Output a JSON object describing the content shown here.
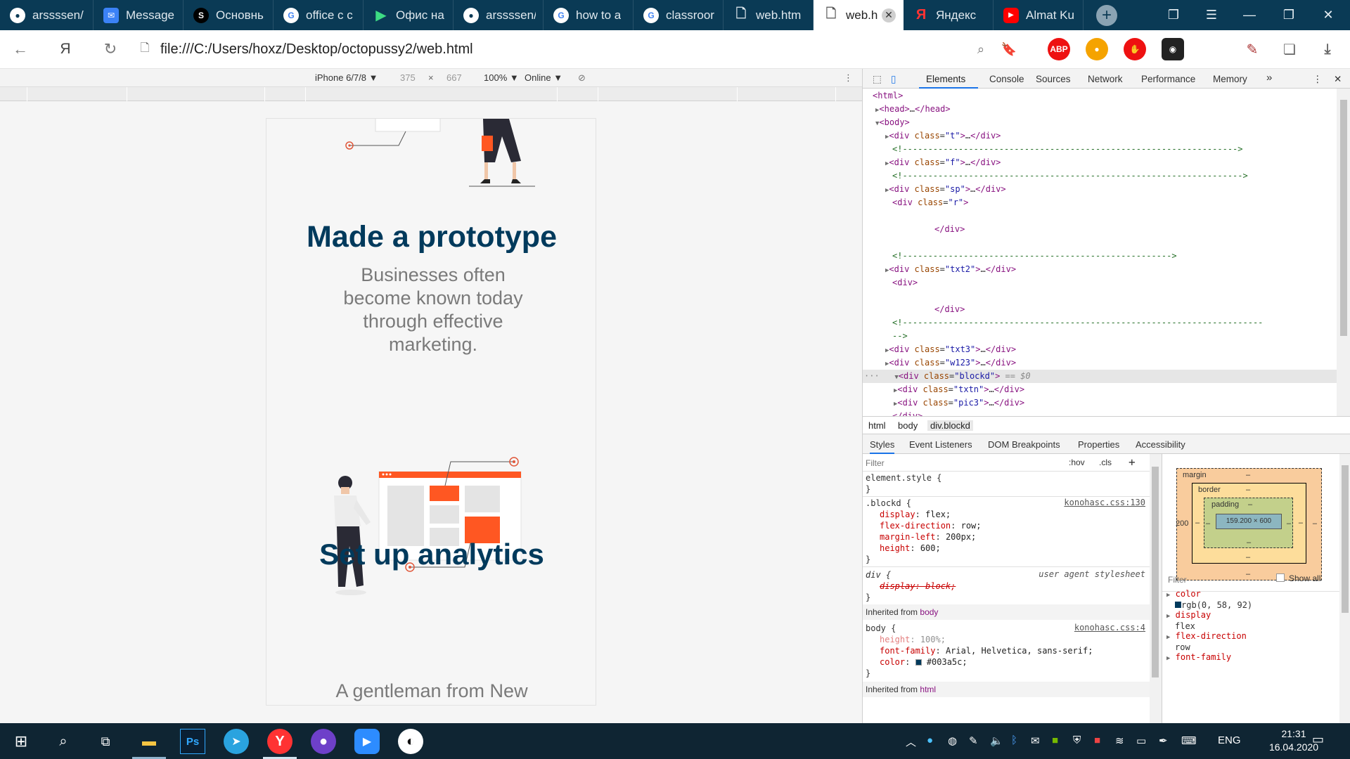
{
  "tabs": [
    {
      "label": "arssssen/",
      "icon": "github-icon"
    },
    {
      "label": "Message",
      "icon": "messenger-icon"
    },
    {
      "label": "Основнь",
      "icon": "app-icon"
    },
    {
      "label": "office c c",
      "icon": "google-icon"
    },
    {
      "label": "Офис на",
      "icon": "play-icon"
    },
    {
      "label": "arssssen/",
      "icon": "github-icon"
    },
    {
      "label": "how to a",
      "icon": "google-icon"
    },
    {
      "label": "classroor",
      "icon": "google-icon"
    },
    {
      "label": "web.htm",
      "icon": "file-icon"
    },
    {
      "label": "web.h",
      "icon": "file-icon",
      "active": true
    },
    {
      "label": "Яндекс",
      "icon": "yandex-icon"
    },
    {
      "label": "Almat Ku",
      "icon": "youtube-icon"
    }
  ],
  "address": {
    "url": "file:///C:/Users/hoxz/Desktop/octopussy2/web.html"
  },
  "device_toolbar": {
    "device": "iPhone 6/7/8",
    "width": "375",
    "times": "×",
    "height": "667",
    "zoom": "100%",
    "network": "Online"
  },
  "page": {
    "heading1": "Made a prototype",
    "text1": [
      "Businesses often",
      "become known today",
      "through effective",
      "marketing."
    ],
    "heading2": "Set up analytics",
    "text2": "A gentleman from New"
  },
  "devtools": {
    "tabs": [
      "Elements",
      "Console",
      "Sources",
      "Network",
      "Performance",
      "Memory"
    ],
    "more": "»",
    "breadcrumbs": [
      "html",
      "body",
      "div.blockd"
    ],
    "subtabs": [
      "Styles",
      "Event Listeners",
      "DOM Breakpoints",
      "Properties",
      "Accessibility"
    ],
    "filter_placeholder": "Filter",
    "hov": ":hov",
    "cls": ".cls",
    "plus": "+",
    "box_filter_placeholder": "Filter",
    "show_all": "Show all",
    "box": {
      "margin_label": "margin",
      "border_label": "border",
      "padding_label": "padding",
      "content": "159.200 × 600",
      "margin_left": "200",
      "dash": "–"
    },
    "computed": [
      {
        "prop": "color",
        "value": "rgb(0, 58, 92)"
      },
      {
        "prop": "display",
        "value": "flex"
      },
      {
        "prop": "flex-direction",
        "value": "row"
      },
      {
        "prop": "font-family",
        "value": ""
      }
    ],
    "styles": {
      "element_style": "element.style {",
      "blockd_selector": ".blockd {",
      "blockd_src": "konohasc.css:130",
      "blockd_props": [
        {
          "p": "display",
          "v": "flex;"
        },
        {
          "p": "flex-direction",
          "v": "row;"
        },
        {
          "p": "margin-left",
          "v": "200px;"
        },
        {
          "p": "height",
          "v": "600;"
        }
      ],
      "ua_selector": "div {",
      "ua_src": "user agent stylesheet",
      "ua_prop": "display: block;",
      "inherited_body": "Inherited from",
      "inherited_body_el": "body",
      "body_selector": "body {",
      "body_src": "konohasc.css:4",
      "body_props": [
        {
          "p": "height",
          "v": "100%;"
        },
        {
          "p": "font-family",
          "v": "Arial, Helvetica, sans-serif;"
        },
        {
          "p": "color",
          "v": "#003a5c;"
        }
      ],
      "inherited_html": "Inherited from",
      "inherited_html_el": "html",
      "close_brace": "}"
    }
  },
  "taskbar": {
    "time": "21:31",
    "date": "16.04.2020",
    "lang": "ENG"
  },
  "colors": {
    "accent": "#ff5722",
    "heading": "#003a5c",
    "tabbar": "#0a3a55"
  }
}
